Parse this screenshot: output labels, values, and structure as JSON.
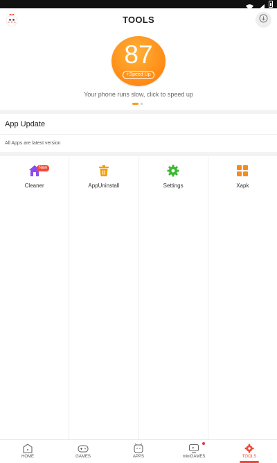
{
  "header": {
    "title": "TOOLS",
    "logo_icon": "chick-mascot-icon",
    "download_icon": "download-icon"
  },
  "score": {
    "value": "87",
    "button_label": "+Speed Up",
    "hint": "Your phone runs slow, click to speed up",
    "pager_total": 2,
    "pager_active": 1
  },
  "app_update": {
    "title": "App Update",
    "status": "All Apps are latest version"
  },
  "tools": [
    {
      "label": "Cleaner",
      "icon": "cleaner-house-icon",
      "badge": "New",
      "color": "#8a4cf0"
    },
    {
      "label": "AppUninstall",
      "icon": "trash-icon",
      "color": "#f5a000"
    },
    {
      "label": "Settings",
      "icon": "gear-icon",
      "color": "#3bb832"
    },
    {
      "label": "Xapk",
      "icon": "grid-icon",
      "color": "#f58a1f"
    }
  ],
  "nav": [
    {
      "label": "HOME",
      "icon": "home-icon"
    },
    {
      "label": "GAMES",
      "icon": "gamepad-icon"
    },
    {
      "label": "APPS",
      "icon": "apps-icon"
    },
    {
      "label": "miniGAMES",
      "icon": "minigames-icon",
      "has_dot": true
    },
    {
      "label": "TOOLS",
      "icon": "tools-gear-icon",
      "active": true
    }
  ],
  "colors": {
    "accent": "#ff8a14",
    "nav_active": "#f04a3a"
  }
}
